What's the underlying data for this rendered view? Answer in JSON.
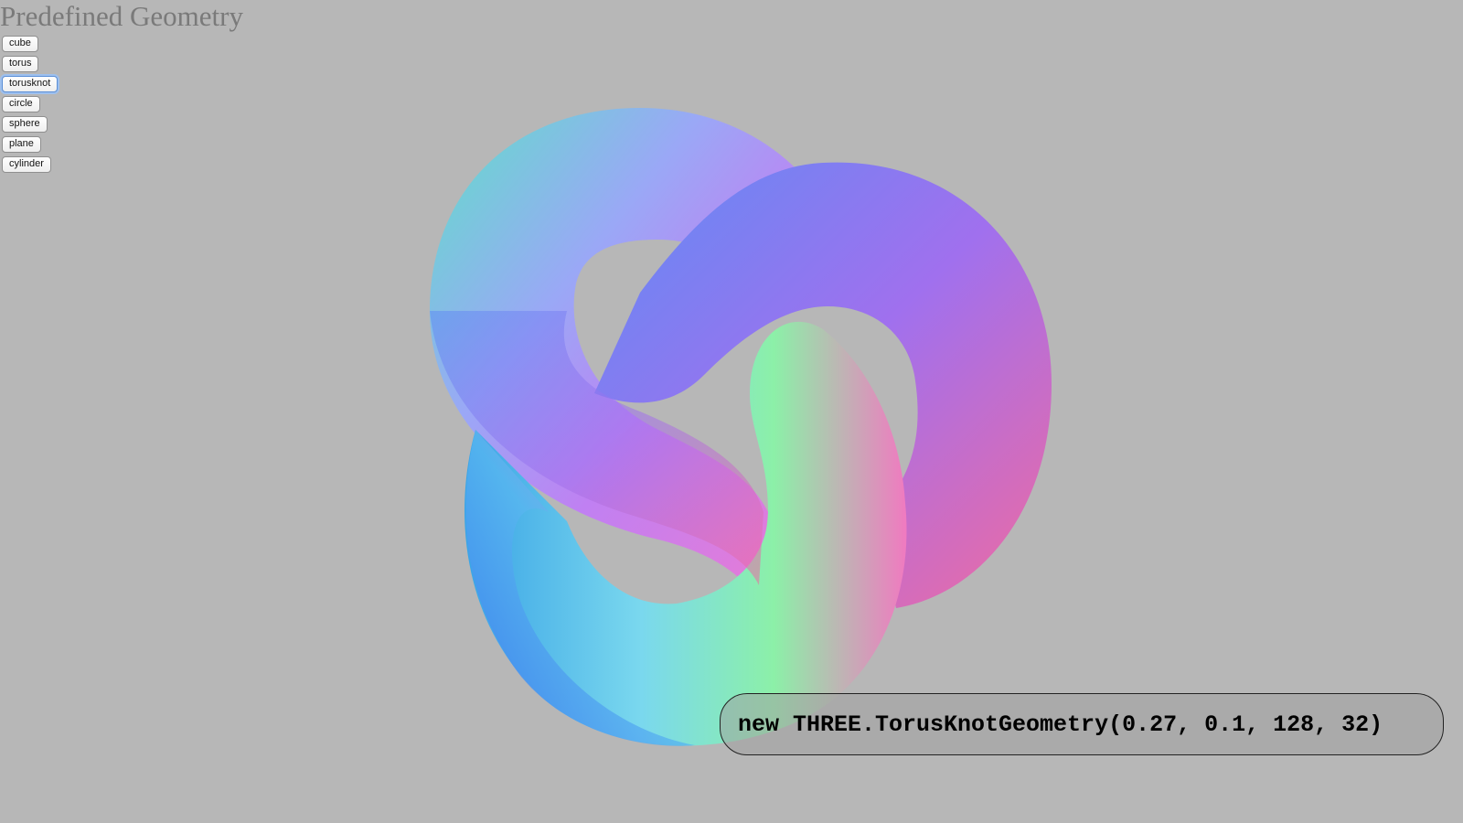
{
  "page": {
    "title": "Predefined Geometry",
    "background_color": "#b7b7b7"
  },
  "buttons": [
    {
      "label": "cube",
      "active": false
    },
    {
      "label": "torus",
      "active": false
    },
    {
      "label": "torusknot",
      "active": true
    },
    {
      "label": "circle",
      "active": false
    },
    {
      "label": "sphere",
      "active": false
    },
    {
      "label": "plane",
      "active": false
    },
    {
      "label": "cylinder",
      "active": false
    }
  ],
  "viewport": {
    "mesh": "torus-knot",
    "material": "normal-material"
  },
  "code_label": {
    "text": "new THREE.TorusKnotGeometry(0.27, 0.1, 128, 32)"
  }
}
